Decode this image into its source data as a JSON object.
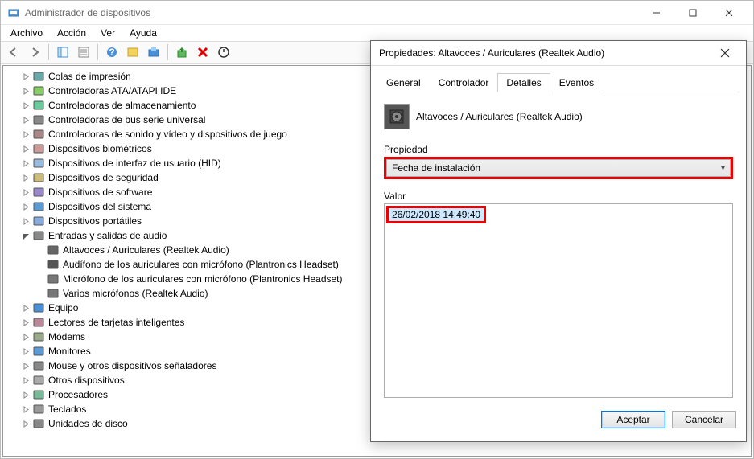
{
  "window": {
    "title": "Administrador de dispositivos"
  },
  "menu": {
    "file": "Archivo",
    "action": "Acción",
    "view": "Ver",
    "help": "Ayuda"
  },
  "tree": {
    "indent_base": 20,
    "indent_step": 18,
    "items": [
      {
        "label": "Colas de impresión",
        "depth": 0,
        "exp": "closed",
        "icon": "printer"
      },
      {
        "label": "Controladoras ATA/ATAPI IDE",
        "depth": 0,
        "exp": "closed",
        "icon": "ide"
      },
      {
        "label": "Controladoras de almacenamiento",
        "depth": 0,
        "exp": "closed",
        "icon": "storage"
      },
      {
        "label": "Controladoras de bus serie universal",
        "depth": 0,
        "exp": "closed",
        "icon": "usb"
      },
      {
        "label": "Controladoras de sonido y vídeo y dispositivos de juego",
        "depth": 0,
        "exp": "closed",
        "icon": "sound"
      },
      {
        "label": "Dispositivos biométricos",
        "depth": 0,
        "exp": "closed",
        "icon": "bio"
      },
      {
        "label": "Dispositivos de interfaz de usuario (HID)",
        "depth": 0,
        "exp": "closed",
        "icon": "hid"
      },
      {
        "label": "Dispositivos de seguridad",
        "depth": 0,
        "exp": "closed",
        "icon": "security"
      },
      {
        "label": "Dispositivos de software",
        "depth": 0,
        "exp": "closed",
        "icon": "software"
      },
      {
        "label": "Dispositivos del sistema",
        "depth": 0,
        "exp": "closed",
        "icon": "system"
      },
      {
        "label": "Dispositivos portátiles",
        "depth": 0,
        "exp": "closed",
        "icon": "portable"
      },
      {
        "label": "Entradas y salidas de audio",
        "depth": 0,
        "exp": "open",
        "icon": "audio"
      },
      {
        "label": "Altavoces / Auriculares (Realtek Audio)",
        "depth": 1,
        "exp": "none",
        "icon": "speaker"
      },
      {
        "label": "Audífono de los auriculares con micrófono (Plantronics Headset)",
        "depth": 1,
        "exp": "none",
        "icon": "headset"
      },
      {
        "label": "Micrófono de los auriculares con micrófono (Plantronics Headset)",
        "depth": 1,
        "exp": "none",
        "icon": "mic"
      },
      {
        "label": "Varios micrófonos (Realtek Audio)",
        "depth": 1,
        "exp": "none",
        "icon": "mic"
      },
      {
        "label": "Equipo",
        "depth": 0,
        "exp": "closed",
        "icon": "computer"
      },
      {
        "label": "Lectores de tarjetas inteligentes",
        "depth": 0,
        "exp": "closed",
        "icon": "smartcard"
      },
      {
        "label": "Módems",
        "depth": 0,
        "exp": "closed",
        "icon": "modem"
      },
      {
        "label": "Monitores",
        "depth": 0,
        "exp": "closed",
        "icon": "monitor"
      },
      {
        "label": "Mouse y otros dispositivos señaladores",
        "depth": 0,
        "exp": "closed",
        "icon": "mouse"
      },
      {
        "label": "Otros dispositivos",
        "depth": 0,
        "exp": "closed",
        "icon": "other"
      },
      {
        "label": "Procesadores",
        "depth": 0,
        "exp": "closed",
        "icon": "cpu"
      },
      {
        "label": "Teclados",
        "depth": 0,
        "exp": "closed",
        "icon": "keyboard"
      },
      {
        "label": "Unidades de disco",
        "depth": 0,
        "exp": "closed",
        "icon": "disk"
      }
    ]
  },
  "dialog": {
    "title": "Propiedades: Altavoces / Auriculares (Realtek Audio)",
    "tabs": {
      "general": "General",
      "driver": "Controlador",
      "details": "Detalles",
      "events": "Eventos"
    },
    "device_name": "Altavoces / Auriculares (Realtek Audio)",
    "property_label": "Propiedad",
    "property_value": "Fecha de instalación",
    "value_label": "Valor",
    "value_text": "26/02/2018 14:49:40",
    "ok": "Aceptar",
    "cancel": "Cancelar"
  }
}
